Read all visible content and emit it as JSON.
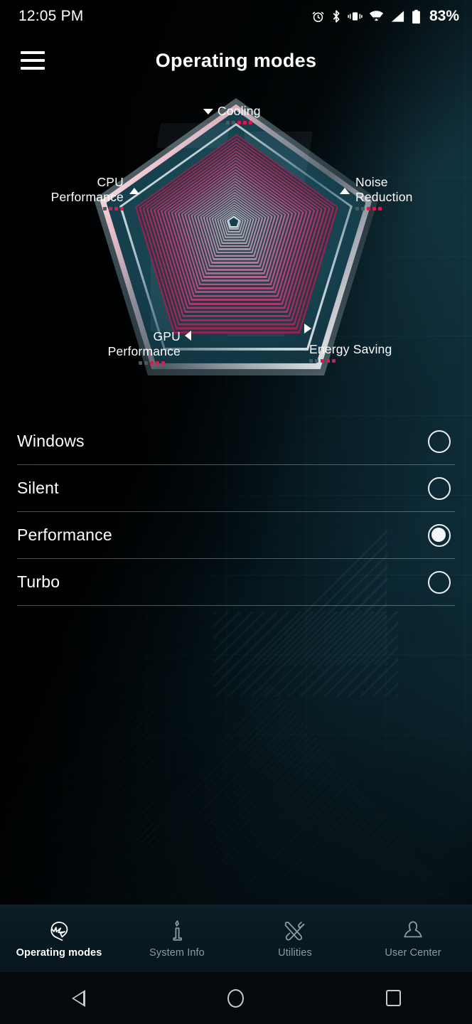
{
  "statusbar": {
    "time": "12:05 PM",
    "battery_percent": "83%",
    "icons": [
      "alarm-icon",
      "bluetooth-icon",
      "vibrate-icon",
      "wifi-icon",
      "cellular-signal-icon",
      "battery-icon"
    ]
  },
  "appbar": {
    "menu_icon": "hamburger-menu-icon",
    "title": "Operating modes"
  },
  "radar": {
    "axes": [
      {
        "name": "cooling",
        "label_line1": "Cooling",
        "label_line2": "",
        "arrow": "down-triangle",
        "dots_total": 5,
        "dots_filled": 3
      },
      {
        "name": "noise-reduction",
        "label_line1": "Noise",
        "label_line2": "Reduction",
        "arrow": "up-triangle",
        "dots_total": 5,
        "dots_filled": 3
      },
      {
        "name": "energy-saving",
        "label_line1": "Energy Saving",
        "label_line2": "",
        "arrow": "right-triangle",
        "dots_total": 5,
        "dots_filled": 3
      },
      {
        "name": "gpu-performance",
        "label_line1": "GPU",
        "label_line2": "Performance",
        "arrow": "left-triangle",
        "dots_total": 5,
        "dots_filled": 3
      },
      {
        "name": "cpu-performance",
        "label_line1": "CPU",
        "label_line2": "Performance",
        "arrow": "up-triangle",
        "dots_total": 5,
        "dots_filled": 3
      }
    ],
    "accent_color": "#e0164f",
    "dot_off_color": "#4a5a62"
  },
  "modes": [
    {
      "label": "Windows",
      "selected": false
    },
    {
      "label": "Silent",
      "selected": false
    },
    {
      "label": "Performance",
      "selected": true
    },
    {
      "label": "Turbo",
      "selected": false
    }
  ],
  "bottomnav": [
    {
      "label": "Operating modes",
      "icon": "helmet-icon",
      "active": true
    },
    {
      "label": "System Info",
      "icon": "info-icon",
      "active": false
    },
    {
      "label": "Utilities",
      "icon": "tools-icon",
      "active": false
    },
    {
      "label": "User Center",
      "icon": "user-icon",
      "active": false
    }
  ],
  "androidnav": [
    {
      "name": "back-button",
      "icon": "back-triangle-icon"
    },
    {
      "name": "home-button",
      "icon": "home-circle-icon"
    },
    {
      "name": "recents-button",
      "icon": "recents-square-icon"
    }
  ]
}
